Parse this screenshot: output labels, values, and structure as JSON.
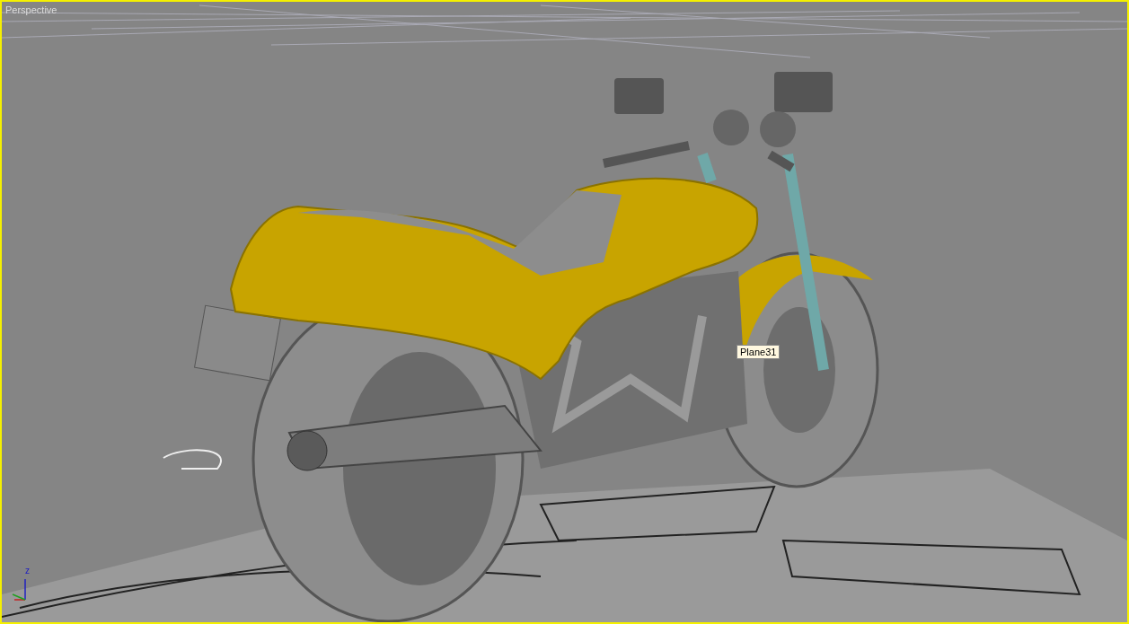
{
  "viewport": {
    "label": "Perspective",
    "active": true
  },
  "tooltip": {
    "text": "Plane31"
  },
  "axis_gizmo": {
    "z_label": "z"
  }
}
